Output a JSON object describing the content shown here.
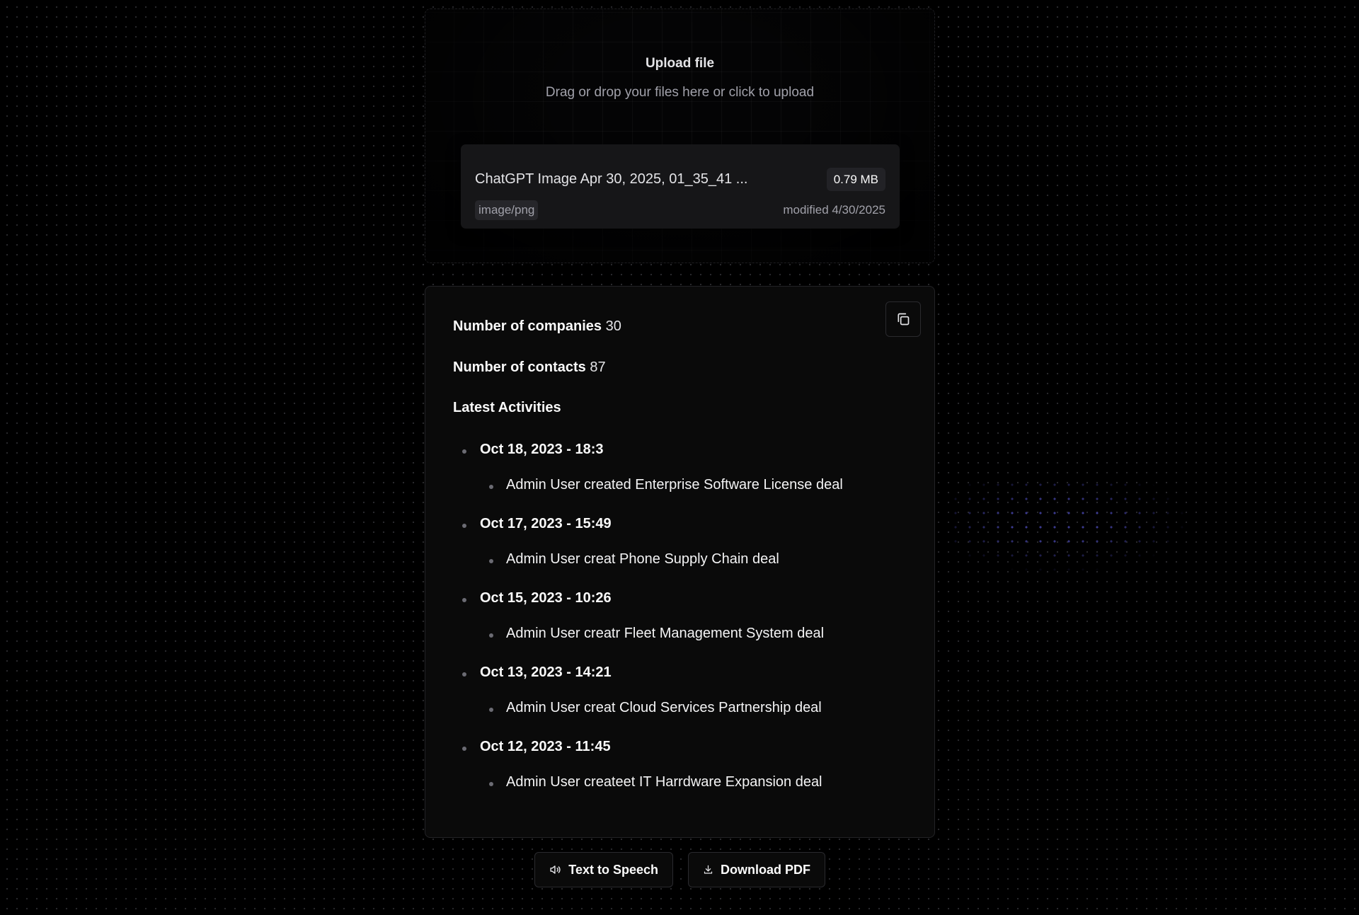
{
  "upload": {
    "title": "Upload file",
    "subtitle": "Drag or drop your files here or click to upload",
    "file": {
      "name": "ChatGPT Image Apr 30, 2025, 01_35_41 ...",
      "size": "0.79 MB",
      "type": "image/png",
      "modified": "modified 4/30/2025"
    }
  },
  "result": {
    "companies_label": "Number of companies",
    "companies_value": "30",
    "contacts_label": "Number of contacts",
    "contacts_value": "87",
    "activities_title": "Latest Activities",
    "activities": [
      {
        "date": "Oct 18, 2023 - 18:3",
        "description": "Admin User created Enterprise Software License deal"
      },
      {
        "date": "Oct 17, 2023 - 15:49",
        "description": "Admin User creat Phone Supply Chain deal"
      },
      {
        "date": "Oct 15, 2023 - 10:26",
        "description": "Admin User creatr Fleet Management System deal"
      },
      {
        "date": "Oct 13, 2023 - 14:21",
        "description": "Admin User creat Cloud Services Partnership deal"
      },
      {
        "date": "Oct 12, 2023 - 11:45",
        "description": "Admin User createet IT Harrdware Expansion deal"
      }
    ]
  },
  "actions": {
    "text_to_speech": "Text to Speech",
    "download_pdf": "Download PDF"
  },
  "icons": {
    "copy": "copy-icon",
    "speaker": "speaker-icon",
    "download": "download-icon"
  },
  "colors": {
    "background": "#000000",
    "card": "#0a0a0a",
    "border": "#232326",
    "accent_dots": "#3b3a8f"
  }
}
